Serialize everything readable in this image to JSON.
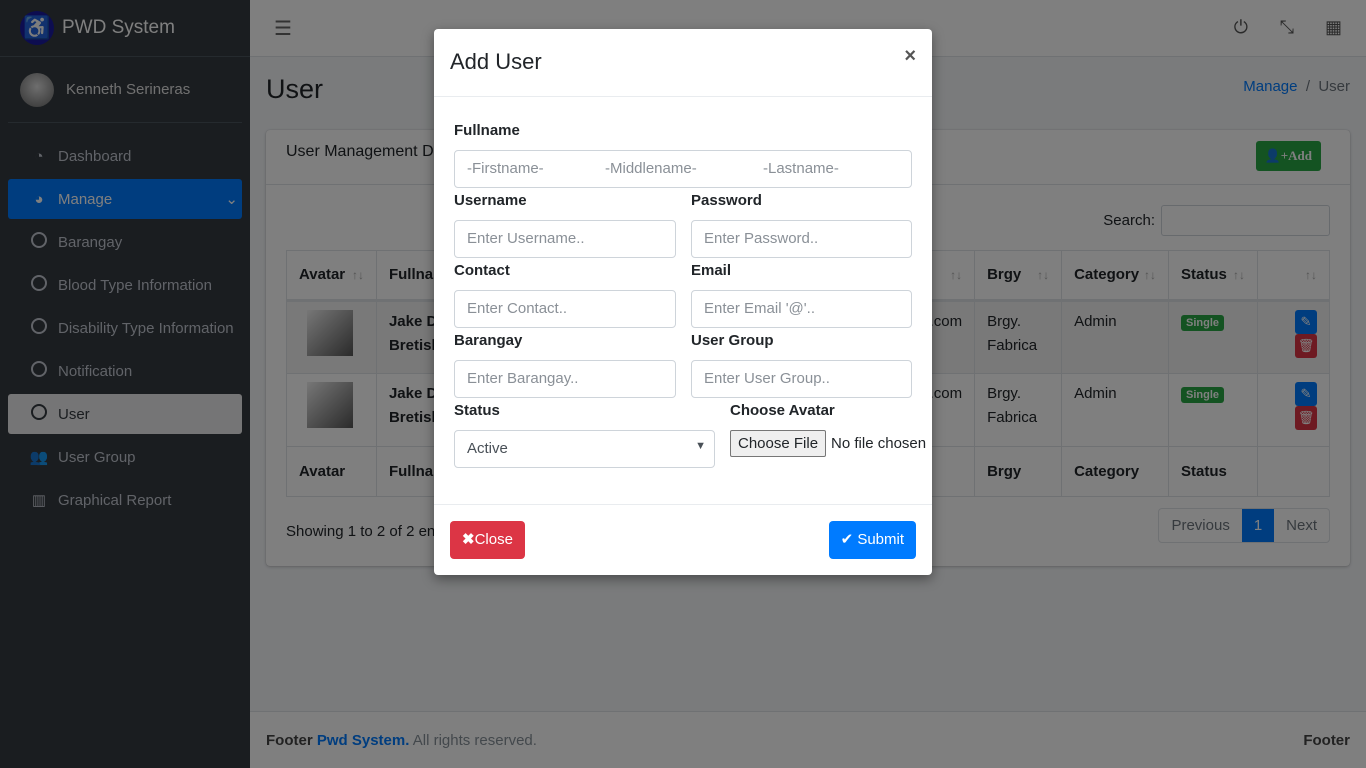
{
  "brand": {
    "name": "PWD System",
    "icon": "wheelchair-icon",
    "user": "Kenneth Serineras"
  },
  "sidebar": {
    "items": [
      {
        "label": "Dashboard",
        "icon": "tachometer-icon",
        "state": ""
      },
      {
        "label": "Manage",
        "icon": "chart-pie-icon",
        "state": "active"
      },
      {
        "label": "Barangay",
        "icon": "circle-icon",
        "state": ""
      },
      {
        "label": "Blood Type Information",
        "icon": "circle-icon",
        "state": ""
      },
      {
        "label": "Disability Type Information",
        "icon": "circle-icon",
        "state": ""
      },
      {
        "label": "Notification",
        "icon": "circle-icon",
        "state": ""
      },
      {
        "label": "User",
        "icon": "circle-icon",
        "state": "sel"
      },
      {
        "label": "User Group",
        "icon": "users-icon",
        "state": ""
      },
      {
        "label": "Graphical Report",
        "icon": "bar-chart-icon",
        "state": ""
      }
    ]
  },
  "page": {
    "title": "User",
    "breadcrumb": [
      "Manage",
      "User"
    ]
  },
  "card": {
    "title": "User Management D",
    "add_label": "Add",
    "search_label": "Search:"
  },
  "table": {
    "headers": [
      "Avatar",
      "Fullnam",
      "",
      "Brgy",
      "Category",
      "Status",
      ""
    ],
    "rows": [
      {
        "name": [
          "Jake D",
          "Bretish"
        ],
        "email": ".com",
        "brgy": [
          "Brgy.",
          "Fabrica"
        ],
        "category": "Admin",
        "status": "Single"
      },
      {
        "name": [
          "Jake D",
          "Bretish"
        ],
        "email": ".com",
        "brgy": [
          "Brgy.",
          "Fabrica"
        ],
        "category": "Admin",
        "status": "Single"
      }
    ],
    "footers": [
      "Avatar",
      "Fullnam",
      "",
      "Brgy",
      "Category",
      "Status",
      ""
    ]
  },
  "info": "Showing 1 to 2 of 2 ent",
  "pagination": {
    "prev": "Previous",
    "current": "1",
    "next": "Next"
  },
  "footer": {
    "prefix": "Footer",
    "brand": "Pwd System.",
    "suffix": "All rights reserved.",
    "right": "Footer"
  },
  "modal": {
    "title": "Add User",
    "close_x": "×",
    "fullname_label": "Fullname",
    "first_ph": "-Firstname-",
    "middle_ph": "-Middlename-",
    "last_ph": "-Lastname-",
    "username_label": "Username",
    "username_ph": "Enter Username..",
    "password_label": "Password",
    "password_ph": "Enter Password..",
    "contact_label": "Contact",
    "contact_ph": "Enter Contact..",
    "email_label": "Email",
    "email_ph": "Enter Email '@'..",
    "barangay_label": "Barangay",
    "barangay_ph": "Enter Barangay..",
    "group_label": "User Group",
    "group_ph": "Enter User Group..",
    "status_label": "Status",
    "status_value": "Active",
    "avatar_label": "Choose Avatar",
    "file_button": "Choose File",
    "file_status": "No file chosen",
    "close_label": "Close",
    "submit_label": "Submit"
  },
  "colors": {
    "primary": "#007bff",
    "success": "#28a745",
    "danger": "#dc3545",
    "sidebar": "#343a40"
  }
}
